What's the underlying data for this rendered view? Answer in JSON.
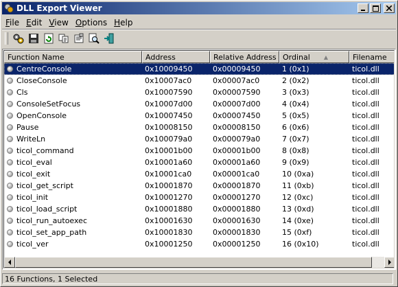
{
  "window": {
    "title": "DLL Export Viewer"
  },
  "menu": [
    {
      "label": "File",
      "u": "F",
      "rest": "ile"
    },
    {
      "label": "Edit",
      "u": "E",
      "rest": "dit"
    },
    {
      "label": "View",
      "u": "V",
      "rest": "iew"
    },
    {
      "label": "Options",
      "u": "O",
      "rest": "ptions"
    },
    {
      "label": "Help",
      "u": "H",
      "rest": "elp"
    }
  ],
  "toolbar": [
    "gears-icon",
    "save-icon",
    "refresh-icon",
    "copy-icon",
    "properties-icon",
    "find-icon",
    "exit-icon"
  ],
  "columns": [
    {
      "label": "Function Name"
    },
    {
      "label": "Address"
    },
    {
      "label": "Relative Address"
    },
    {
      "label": "Ordinal",
      "sorted": true
    },
    {
      "label": "Filename"
    }
  ],
  "rows": [
    [
      "CentreConsole",
      "0x10009450",
      "0x00009450",
      "1 (0x1)",
      "ticol.dll"
    ],
    [
      "CloseConsole",
      "0x10007ac0",
      "0x00007ac0",
      "2 (0x2)",
      "ticol.dll"
    ],
    [
      "Cls",
      "0x10007590",
      "0x00007590",
      "3 (0x3)",
      "ticol.dll"
    ],
    [
      "ConsoleSetFocus",
      "0x10007d00",
      "0x00007d00",
      "4 (0x4)",
      "ticol.dll"
    ],
    [
      "OpenConsole",
      "0x10007450",
      "0x00007450",
      "5 (0x5)",
      "ticol.dll"
    ],
    [
      "Pause",
      "0x10008150",
      "0x00008150",
      "6 (0x6)",
      "ticol.dll"
    ],
    [
      "WriteLn",
      "0x100079a0",
      "0x000079a0",
      "7 (0x7)",
      "ticol.dll"
    ],
    [
      "ticol_command",
      "0x10001b00",
      "0x00001b00",
      "8 (0x8)",
      "ticol.dll"
    ],
    [
      "ticol_eval",
      "0x10001a60",
      "0x00001a60",
      "9 (0x9)",
      "ticol.dll"
    ],
    [
      "ticol_exit",
      "0x10001ca0",
      "0x00001ca0",
      "10 (0xa)",
      "ticol.dll"
    ],
    [
      "ticol_get_script",
      "0x10001870",
      "0x00001870",
      "11 (0xb)",
      "ticol.dll"
    ],
    [
      "ticol_init",
      "0x10001270",
      "0x00001270",
      "12 (0xc)",
      "ticol.dll"
    ],
    [
      "ticol_load_script",
      "0x10001880",
      "0x00001880",
      "13 (0xd)",
      "ticol.dll"
    ],
    [
      "ticol_run_autoexec",
      "0x10001630",
      "0x00001630",
      "14 (0xe)",
      "ticol.dll"
    ],
    [
      "ticol_set_app_path",
      "0x10001830",
      "0x00001830",
      "15 (0xf)",
      "ticol.dll"
    ],
    [
      "ticol_ver",
      "0x10001250",
      "0x00001250",
      "16 (0x10)",
      "ticol.dll"
    ]
  ],
  "selected_row": 0,
  "status": {
    "text": "16 Functions, 1 Selected"
  },
  "colors": {
    "selection": "#0a246a",
    "titlebar_start": "#0a246a",
    "titlebar_end": "#a6caf0"
  }
}
